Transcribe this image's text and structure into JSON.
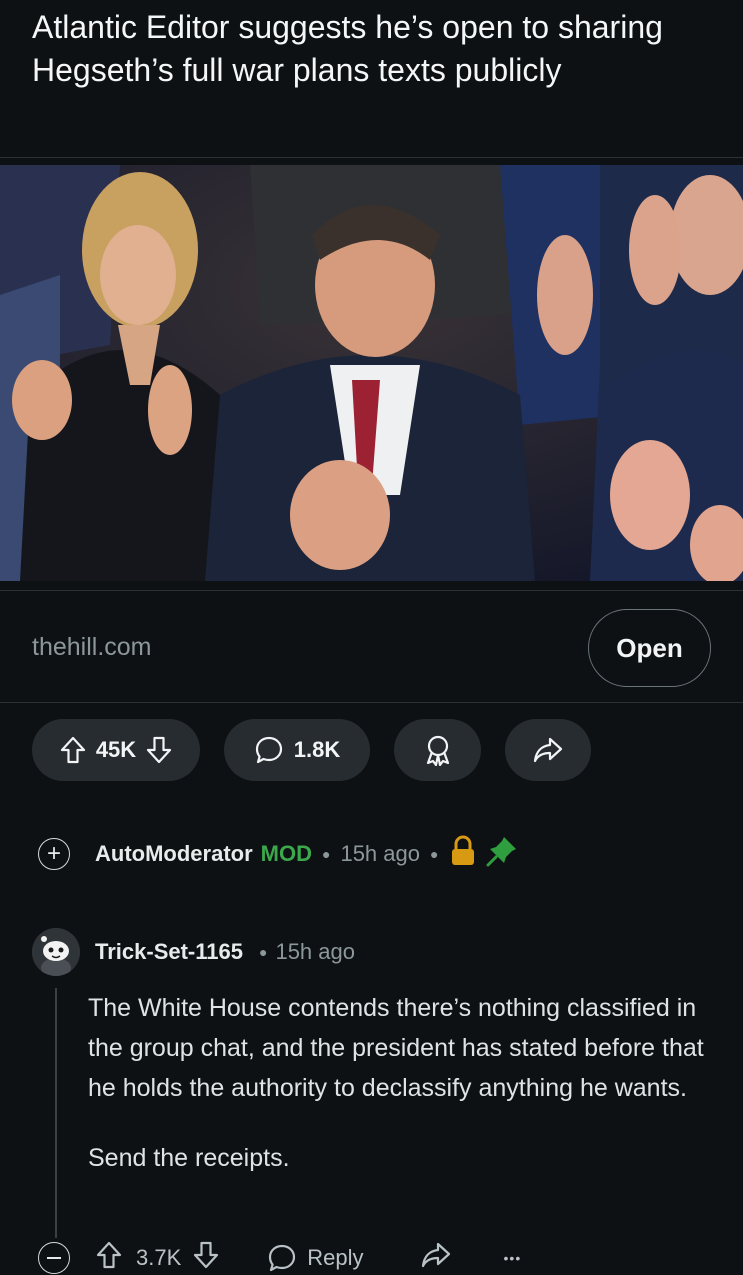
{
  "post": {
    "title": "Atlantic Editor suggests he’s open to sharing Hegseth’s full war plans texts publicly",
    "domain": "thehill.com",
    "open_label": "Open",
    "votes": "45K",
    "comments": "1.8K"
  },
  "automod": {
    "username": "AutoModerator",
    "badge": "MOD",
    "time": "15h ago",
    "lock_icon": "lock-icon",
    "pin_icon": "pin-icon"
  },
  "comment": {
    "username": "Trick-Set-1165",
    "time": "15h ago",
    "paragraph1": "The White House contends there’s nothing classified in the group chat, and the president has stated before that he holds the authority to declassify anything he wants.",
    "paragraph2": "Send the receipts.",
    "votes": "3.7K",
    "reply_label": "Reply",
    "more_label": "•••"
  },
  "colors": {
    "background": "#0e1113",
    "pill": "#272c30",
    "mod_green": "#3ba84b",
    "lock_gold": "#d79a12",
    "muted": "#8c979c"
  }
}
